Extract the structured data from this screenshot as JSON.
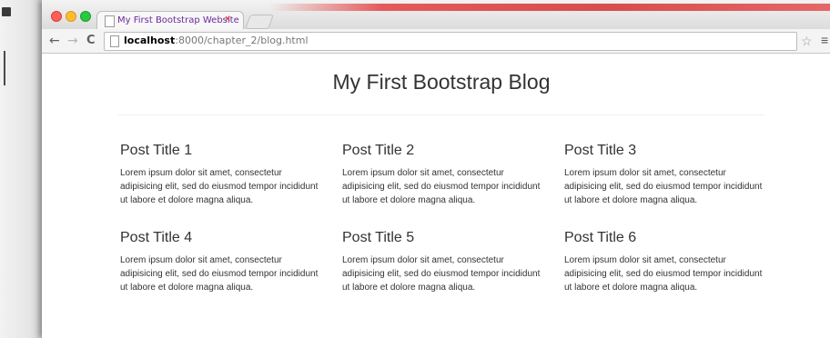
{
  "browser": {
    "tab_title": "My First Bootstrap Website",
    "tab_close": "×",
    "url_host": "localhost",
    "url_rest": ":8000/chapter_2/blog.html",
    "nav_back": "←",
    "nav_forward": "→",
    "nav_reload": "C",
    "star": "☆",
    "menu": "≡"
  },
  "page": {
    "title": "My First Bootstrap Blog",
    "posts": [
      {
        "title": "Post Title 1",
        "body": "Lorem ipsum dolor sit amet, consectetur adipisicing elit, sed do eiusmod tempor incididunt ut labore et dolore magna aliqua."
      },
      {
        "title": "Post Title 2",
        "body": "Lorem ipsum dolor sit amet, consectetur adipisicing elit, sed do eiusmod tempor incididunt ut labore et dolore magna aliqua."
      },
      {
        "title": "Post Title 3",
        "body": "Lorem ipsum dolor sit amet, consectetur adipisicing elit, sed do eiusmod tempor incididunt ut labore et dolore magna aliqua."
      },
      {
        "title": "Post Title 4",
        "body": "Lorem ipsum dolor sit amet, consectetur adipisicing elit, sed do eiusmod tempor incididunt ut labore et dolore magna aliqua."
      },
      {
        "title": "Post Title 5",
        "body": "Lorem ipsum dolor sit amet, consectetur adipisicing elit, sed do eiusmod tempor incididunt ut labore et dolore magna aliqua."
      },
      {
        "title": "Post Title 6",
        "body": "Lorem ipsum dolor sit amet, consectetur adipisicing elit, sed do eiusmod tempor incididunt ut labore et dolore magna aliqua."
      }
    ]
  },
  "colors": {
    "close": "#ff5f57",
    "minimize": "#febc2e",
    "maximize": "#28c840",
    "text": "#333333"
  }
}
